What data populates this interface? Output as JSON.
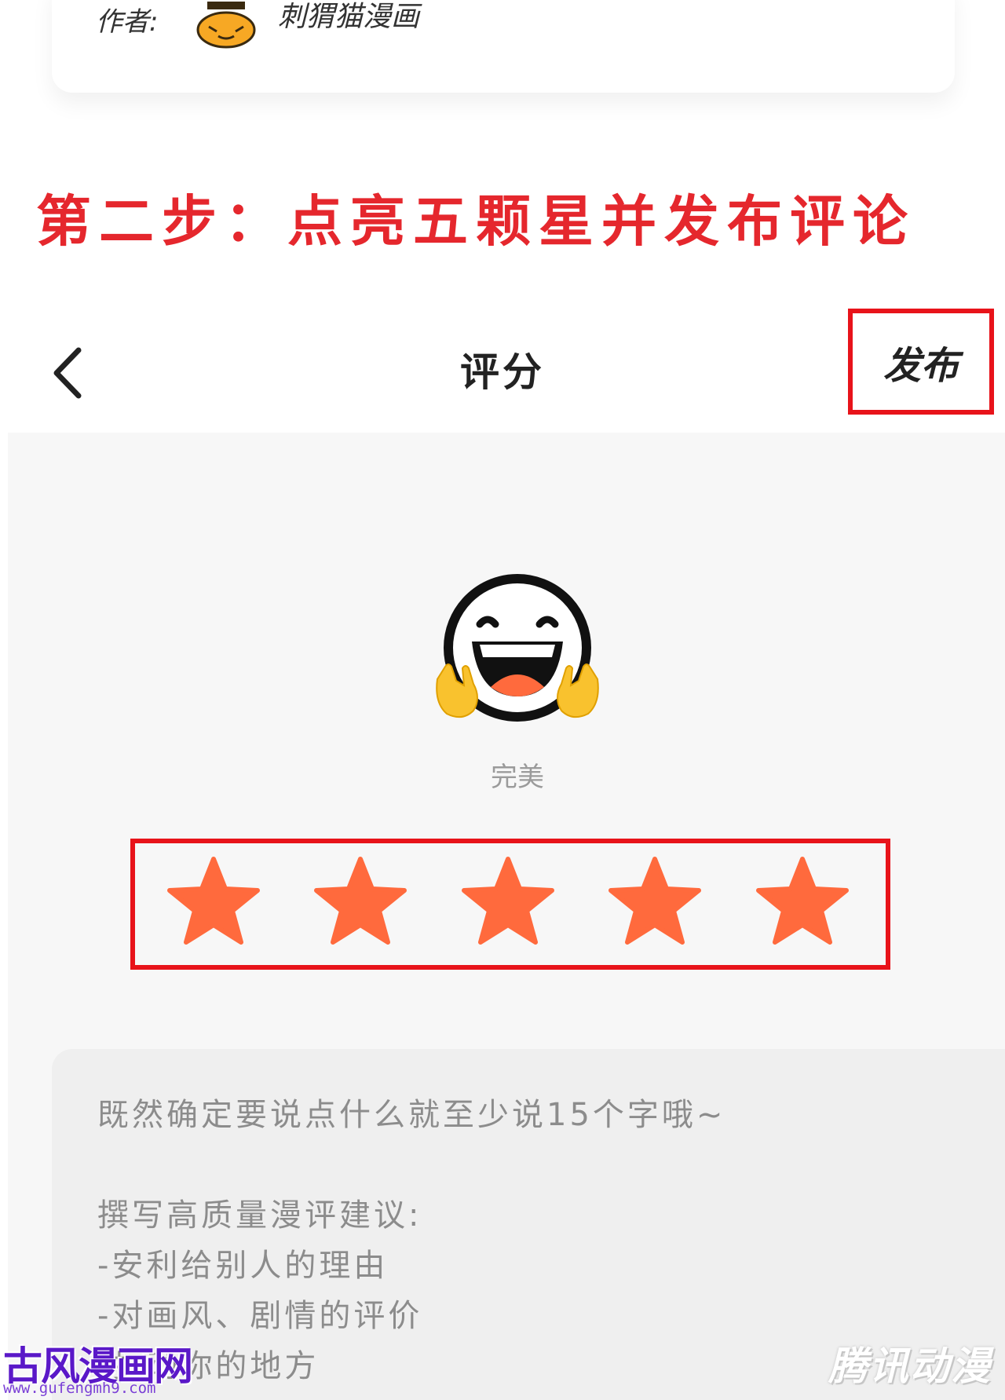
{
  "author_card": {
    "label": "作者:",
    "name": "刺猬猫漫画"
  },
  "instruction": {
    "heading": "第二步：点亮五颗星并发布评论"
  },
  "nav": {
    "title": "评分",
    "publish_label": "发布"
  },
  "rating": {
    "label": "完美",
    "value": 5,
    "max": 5,
    "star_color": "#ff6a3d"
  },
  "comment": {
    "placeholder": "既然确定要说点什么就至少说15个字哦~\n\n撰写高质量漫评建议:\n-安利给别人的理由\n-对画风、剧情的评价\n-打动你的地方"
  },
  "watermarks": {
    "left_title": "古风漫画网",
    "left_url": "www.gufengmh9.com",
    "right": "腾讯动漫"
  },
  "colors": {
    "highlight_border": "#e8131a",
    "heading_red": "#e5272d"
  }
}
